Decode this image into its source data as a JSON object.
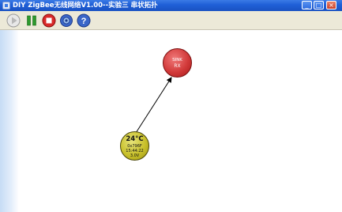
{
  "window": {
    "title": "DIY ZigBee无线网络V1.00--实验三 串状拓扑",
    "minimize_label": "_",
    "maximize_label": "□",
    "close_label": "×"
  },
  "toolbar": {
    "buttons": [
      {
        "icon": "play-icon"
      },
      {
        "icon": "pause-icon"
      },
      {
        "icon": "stop-icon"
      },
      {
        "icon": "gear-icon"
      },
      {
        "icon": "help-icon"
      }
    ]
  },
  "nodes": {
    "sink": {
      "line1": "SINK",
      "line2": "RX",
      "color": "#d23a3a"
    },
    "sensor": {
      "temp": "24°C",
      "addr": "0x796F",
      "time": "15:44:22",
      "voltage": "3.0V",
      "color": "#c8c02a"
    }
  }
}
